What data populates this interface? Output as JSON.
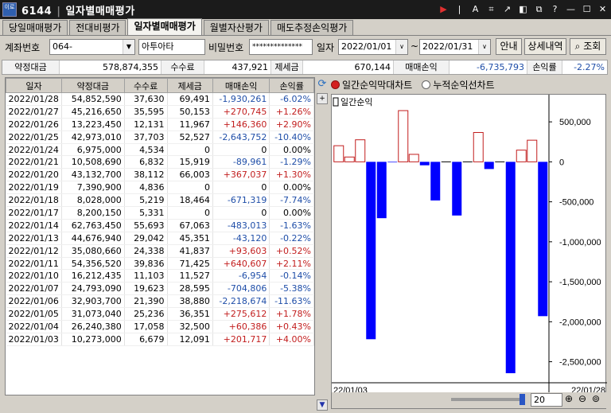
{
  "window": {
    "screen_no": "6144",
    "title": "일자별매매평가",
    "logo_text": "이로"
  },
  "tabs": [
    "당일매매평가",
    "전대비평가",
    "일자별매매평가",
    "월별자산평가",
    "매도추정손익평가"
  ],
  "form": {
    "account_label": "계좌번호",
    "account_value": "064-",
    "account_name": "아투아타",
    "password_label": "비밀번호",
    "password_value": "**************",
    "date_label": "일자",
    "date_from": "2022/01/01",
    "tilde": "~",
    "date_to": "2022/01/31",
    "btn_guide": "안내",
    "btn_detail": "상세내역",
    "btn_search": "조회"
  },
  "summary": {
    "trade_amount_label": "약정대금",
    "trade_amount": "578,874,355",
    "fee_label": "수수료",
    "fee": "437,921",
    "tax_label": "제세금",
    "tax": "670,144",
    "pnl_label": "매매손익",
    "pnl": "-6,735,793",
    "rate_label": "손익률",
    "rate": "-2.27%"
  },
  "table": {
    "headers": [
      "일자",
      "약정대금",
      "수수료",
      "제세금",
      "매매손익",
      "손익률"
    ],
    "rows": [
      [
        "2022/01/28",
        "54,852,590",
        "37,630",
        "69,491",
        "-1,930,261",
        "-6.02%"
      ],
      [
        "2022/01/27",
        "45,216,650",
        "35,595",
        "50,153",
        "+270,745",
        "+1.26%"
      ],
      [
        "2022/01/26",
        "13,223,450",
        "12,131",
        "11,967",
        "+146,360",
        "+2.90%"
      ],
      [
        "2022/01/25",
        "42,973,010",
        "37,703",
        "52,527",
        "-2,643,752",
        "-10.40%"
      ],
      [
        "2022/01/24",
        "6,975,000",
        "4,534",
        "0",
        "0",
        "0.00%"
      ],
      [
        "2022/01/21",
        "10,508,690",
        "6,832",
        "15,919",
        "-89,961",
        "-1.29%"
      ],
      [
        "2022/01/20",
        "43,132,700",
        "38,112",
        "66,003",
        "+367,037",
        "+1.30%"
      ],
      [
        "2022/01/19",
        "7,390,900",
        "4,836",
        "0",
        "0",
        "0.00%"
      ],
      [
        "2022/01/18",
        "8,028,000",
        "5,219",
        "18,464",
        "-671,319",
        "-7.74%"
      ],
      [
        "2022/01/17",
        "8,200,150",
        "5,331",
        "0",
        "0",
        "0.00%"
      ],
      [
        "2022/01/14",
        "62,763,450",
        "55,693",
        "67,063",
        "-483,013",
        "-1.63%"
      ],
      [
        "2022/01/13",
        "44,676,940",
        "29,042",
        "45,351",
        "-43,120",
        "-0.22%"
      ],
      [
        "2022/01/12",
        "35,080,660",
        "24,338",
        "41,837",
        "+93,603",
        "+0.52%"
      ],
      [
        "2022/01/11",
        "54,356,520",
        "39,836",
        "71,425",
        "+640,607",
        "+2.11%"
      ],
      [
        "2022/01/10",
        "16,212,435",
        "11,103",
        "11,527",
        "-6,954",
        "-0.14%"
      ],
      [
        "2022/01/07",
        "24,793,090",
        "19,623",
        "28,595",
        "-704,806",
        "-5.38%"
      ],
      [
        "2022/01/06",
        "32,903,700",
        "21,390",
        "38,880",
        "-2,218,674",
        "-11.63%"
      ],
      [
        "2022/01/05",
        "31,073,040",
        "25,236",
        "36,351",
        "+275,612",
        "+1.78%"
      ],
      [
        "2022/01/04",
        "26,240,380",
        "17,058",
        "32,500",
        "+60,386",
        "+0.43%"
      ],
      [
        "2022/01/03",
        "10,273,000",
        "6,679",
        "12,091",
        "+201,717",
        "+4.00%"
      ]
    ]
  },
  "chart_options": {
    "daily_bar": "일간순익막대차트",
    "cumulative_line": "누적순익선차트",
    "selected": "daily_bar"
  },
  "chart_data": {
    "type": "bar",
    "legend": "일간순익",
    "categories": [
      "2022/01/03",
      "2022/01/04",
      "2022/01/05",
      "2022/01/06",
      "2022/01/07",
      "2022/01/10",
      "2022/01/11",
      "2022/01/12",
      "2022/01/13",
      "2022/01/14",
      "2022/01/17",
      "2022/01/18",
      "2022/01/19",
      "2022/01/20",
      "2022/01/21",
      "2022/01/24",
      "2022/01/25",
      "2022/01/26",
      "2022/01/27",
      "2022/01/28"
    ],
    "values": [
      201717,
      60386,
      275612,
      -2218674,
      -704806,
      -6954,
      640607,
      93603,
      -43120,
      -483013,
      0,
      -671319,
      0,
      367037,
      -89961,
      0,
      -2643752,
      146360,
      270745,
      -1930261
    ],
    "ylim": [
      -2643752,
      640607
    ],
    "yticks": [
      500000,
      0,
      -500000,
      -1000000,
      -1500000,
      -2000000,
      -2500000
    ],
    "ytick_labels": [
      "500,000",
      "0",
      "-500,000",
      "-1,000,000",
      "-1,500,000",
      "-2,000,000",
      "-2,500,000"
    ],
    "x_start_label": "22/01/03",
    "x_end_label": "22/01/28",
    "positive_color": "#c21e1e",
    "negative_color": "#0000ff"
  },
  "chart_footer": {
    "count": "20"
  }
}
